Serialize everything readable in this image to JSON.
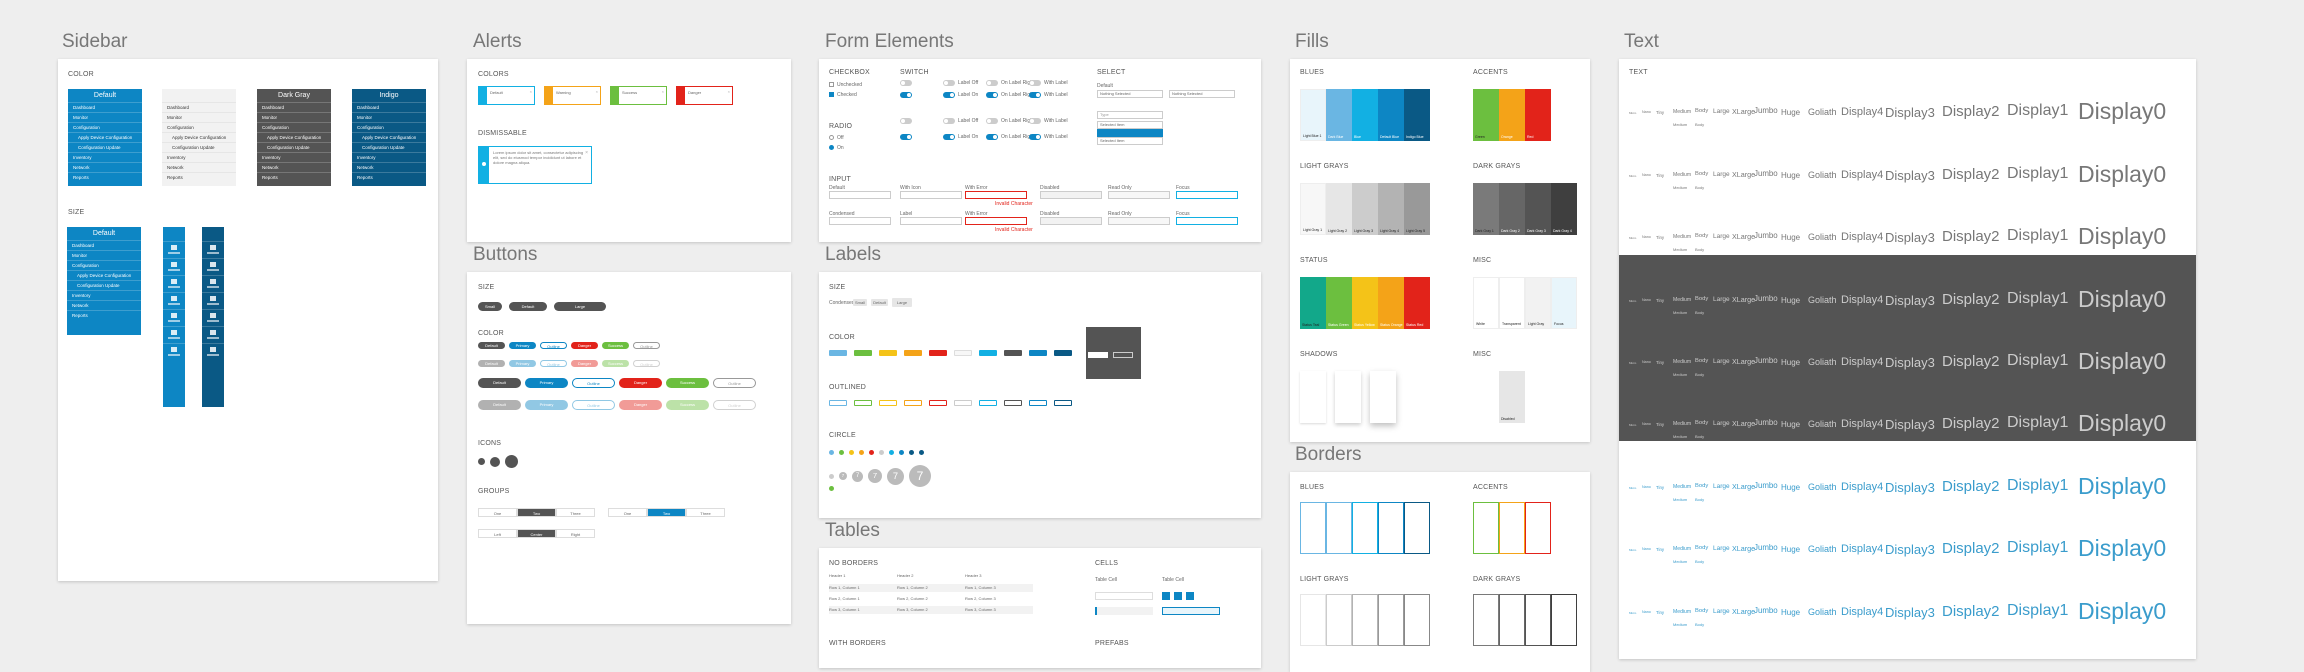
{
  "sections": {
    "sidebar": "Sidebar",
    "alerts": "Alerts",
    "form_elements": "Form Elements",
    "fills": "Fills",
    "text": "Text",
    "buttons": "Buttons",
    "labels": "Labels",
    "tables": "Tables",
    "borders": "Borders"
  },
  "sidebar": {
    "color_label": "COLOR",
    "size_label": "SIZE",
    "variants": [
      {
        "name": "Default",
        "bg": "#0d86c4",
        "text": "#ffffff"
      },
      {
        "name": "",
        "bg": "#f2f2f2",
        "text": "#333333"
      },
      {
        "name": "Dark Gray",
        "bg": "#545454",
        "text": "#ffffff"
      },
      {
        "name": "Indigo",
        "bg": "#0a5985",
        "text": "#ffffff"
      }
    ],
    "items": [
      "Dashboard",
      "Monitor",
      "Configuration",
      "Apply Device Configuration",
      "Configuration Update",
      "Inventory",
      "Network",
      "Reports"
    ],
    "size_default": "Default",
    "size_items": [
      "Dashboard",
      "Monitor",
      "Configuration",
      "Apply Device Configuration",
      "Configuration Update",
      "Inventory",
      "Network",
      "Reports"
    ]
  },
  "alerts": {
    "colors_label": "COLORS",
    "dismissable_label": "DISMISSABLE",
    "items": [
      {
        "text": "Default",
        "color": "#12b0e3"
      },
      {
        "text": "Warning",
        "color": "#f4a318"
      },
      {
        "text": "Success",
        "color": "#6cbf3f"
      },
      {
        "text": "Danger",
        "color": "#e2231a"
      }
    ],
    "dismiss_text": "Lorem ipsum dolor sit amet, consectetur adipiscing elit, sed do eiusmod tempor incididunt ut labore et dolore magna aliqua."
  },
  "form": {
    "checkbox": "CHECKBOX",
    "switch": "SWITCH",
    "select": "SELECT",
    "radio": "RADIO",
    "input": "INPUT",
    "checkbox_items": [
      "Unchecked",
      "Checked"
    ],
    "radio_items": [
      "Off",
      "On"
    ],
    "switch_items": [
      "Off",
      "Label Off",
      "On Label Right",
      "With Label",
      "On",
      "Label On",
      "On Label Right",
      "With Label"
    ],
    "select_default": "Default",
    "select_value": "Nothing Selected",
    "select_options": [
      "Type",
      "Selected Item",
      "Selected Item"
    ],
    "input_labels": [
      "Default",
      "With Icon",
      "With Error",
      "Disabled",
      "Read Only",
      "Focus"
    ],
    "input_error": "Invalid Character",
    "input_labels2": [
      "Condensed",
      "Label",
      "With Error",
      "Disabled",
      "Read Only",
      "Focus"
    ]
  },
  "buttons": {
    "size_label": "SIZE",
    "size_items": [
      "Small",
      "Default",
      "Large"
    ],
    "color_label": "COLOR",
    "icons_label": "ICONS",
    "groups_label": "GROUPS",
    "row1": [
      {
        "text": "Default",
        "bg": "#545454",
        "fg": "#ffffff"
      },
      {
        "text": "Primary",
        "bg": "#0d86c4",
        "fg": "#ffffff"
      },
      {
        "text": "Outline",
        "bg": "#ffffff",
        "fg": "#0d86c4"
      },
      {
        "text": "Danger",
        "bg": "#e2231a",
        "fg": "#ffffff"
      },
      {
        "text": "Success",
        "bg": "#6cbf3f",
        "fg": "#ffffff"
      },
      {
        "text": "Outline",
        "bg": "#ffffff",
        "fg": "#999999"
      }
    ],
    "groups": [
      "One",
      "Two",
      "Three"
    ],
    "groups2": [
      "Left",
      "Center",
      "Right"
    ]
  },
  "labels": {
    "size_label": "SIZE",
    "color_label": "COLOR",
    "outlined_label": "OUTLINED",
    "circle_label": "CIRCLE",
    "size_items": [
      "Condensed",
      "Small",
      "Default",
      "Large"
    ],
    "circle_number": "7",
    "colors": [
      "#6ab6e3",
      "#6cbf3f",
      "#f4c318",
      "#f4a318",
      "#e2231a",
      "#f7f7f7",
      "#12b0e3",
      "#545454",
      "#0d86c4",
      "#0a5985"
    ]
  },
  "tables": {
    "no_borders": "NO BORDERS",
    "cells": "CELLS",
    "with_borders": "WITH BORDERS",
    "prefabs": "PREFABS",
    "headers": [
      "Header 1",
      "Header 2",
      "Header 3"
    ],
    "rows": [
      [
        "Row 1, Column 1",
        "Row 1, Column 2",
        "Row 1, Column 3"
      ],
      [
        "Row 2, Column 1",
        "Row 2, Column 2",
        "Row 2, Column 3"
      ],
      [
        "Row 3, Column 1",
        "Row 3, Column 2",
        "Row 3, Column 3"
      ]
    ],
    "cell_labels": [
      "Table Cell",
      "Table Cell"
    ]
  },
  "fills": {
    "blues": "BLUES",
    "accents": "ACCENTS",
    "light_grays": "LIGHT GRAYS",
    "dark_grays": "DARK GRAYS",
    "status": "STATUS",
    "misc": "MISC",
    "shadows": "SHADOWS",
    "misc2": "MISC",
    "blue_colors": [
      "#e8f5fb",
      "#6ab6e3",
      "#12b0e3",
      "#0d86c4",
      "#0a5985"
    ],
    "blue_names": [
      "Light Blue 1",
      "Dark Blue",
      "Blue",
      "Default Blue",
      "Indigo Blue"
    ],
    "accent_colors": [
      "#6cbf3f",
      "#f4a318",
      "#e2231a"
    ],
    "accent_names": [
      "Green",
      "Orange",
      "Red"
    ],
    "lightgray_colors": [
      "#f7f7f7",
      "#e6e6e6",
      "#cccccc",
      "#b3b3b3",
      "#999999"
    ],
    "lightgray_names": [
      "Light Gray 1",
      "Light Gray 2",
      "Light Gray 3",
      "Light Gray 4",
      "Light Gray 5"
    ],
    "darkgray_colors": [
      "#7a7a7a",
      "#666666",
      "#545454",
      "#3f3f3f"
    ],
    "darkgray_names": [
      "Dark Gray 1",
      "Dark Gray 2",
      "Dark Gray 3",
      "Dark Gray 4"
    ],
    "status_colors": [
      "#12a88a",
      "#6cbf3f",
      "#f4c318",
      "#f4a318",
      "#e2231a"
    ],
    "status_names": [
      "Status Teal",
      "Status Green",
      "Status Yellow",
      "Status Orange",
      "Status Red"
    ],
    "misc_colors": [
      "#ffffff",
      "#ffffff",
      "#f2f2f2",
      "#e8f5fb"
    ],
    "misc_names": [
      "White",
      "Transparent",
      "Light Gray",
      "Focus"
    ],
    "misc2_name": "Disabled"
  },
  "borders": {
    "blues": "BLUES",
    "accents": "ACCENTS",
    "light_grays": "LIGHT GRAYS",
    "dark_grays": "DARK GRAYS",
    "blue_colors": [
      "#6ab6e3",
      "#6ab6e3",
      "#12b0e3",
      "#0d86c4",
      "#0a5985"
    ],
    "accent_colors": [
      "#6cbf3f",
      "#f4a318",
      "#e2231a"
    ],
    "lightgray_colors": [
      "#e6e6e6",
      "#cccccc",
      "#b3b3b3",
      "#999999",
      "#888888"
    ],
    "darkgray_colors": [
      "#7a7a7a",
      "#666666",
      "#545454",
      "#3f3f3f"
    ]
  },
  "text": {
    "label": "TEXT",
    "small_sizes": [
      "Micro",
      "Nano",
      "Tiny",
      "Medium",
      "Body",
      "Large",
      "XLarge",
      "Jumbo"
    ],
    "sub_sizes": [
      "Medium",
      "Body"
    ],
    "huge": "Huge",
    "goliath": "Goliath",
    "d4": "Display4",
    "d3": "Display3",
    "d2": "Display2",
    "d1": "Display1",
    "d0": "Display0",
    "colors": [
      "#777777",
      "#777777",
      "#777777",
      "#cccccc",
      "#cccccc",
      "#cccccc",
      "#3a9ccc",
      "#3a9ccc",
      "#3a9ccc"
    ],
    "row_bg": [
      "#ffffff",
      "#ffffff",
      "#ffffff",
      "#545454",
      "#545454",
      "#545454",
      "#ffffff",
      "#ffffff",
      "#ffffff"
    ]
  }
}
